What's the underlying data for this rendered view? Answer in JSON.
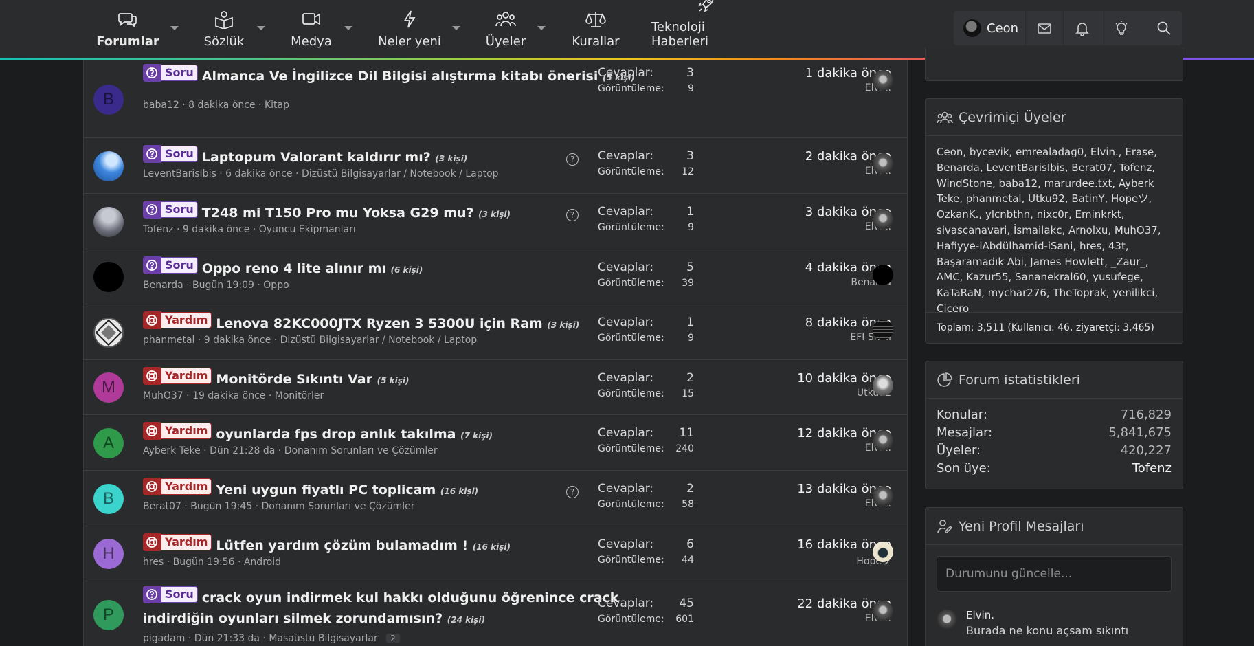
{
  "nav": {
    "items": [
      {
        "label": "Forumlar",
        "icon": "chat-bubbles-icon"
      },
      {
        "label": "Sözlük",
        "icon": "book-icon"
      },
      {
        "label": "Medya",
        "icon": "video-camera-icon"
      },
      {
        "label": "Neler yeni",
        "icon": "lightning-icon"
      },
      {
        "label": "Üyeler",
        "icon": "users-icon"
      },
      {
        "label": "Kurallar",
        "icon": "scales-icon"
      },
      {
        "label": "Teknoloji Haberleri",
        "icon": "rocket-icon"
      }
    ],
    "username": "Ceon",
    "rainbow_colors": [
      "#19c0b0",
      "#a7cf3c",
      "#f2c41c",
      "#f28a1e",
      "#e04a6a",
      "#8a4ee0"
    ]
  },
  "threads": [
    {
      "avatar_letter": "B",
      "avatar_color": "#3a2a8c",
      "prefix": "Soru",
      "title": "Almanca Ve İngilizce Dil Bilgisi alıştırma kitabı önerisi",
      "viewers": "(5 kişi)",
      "author": "baba12",
      "when": "8 dakika önce",
      "forum": "Kitap",
      "replies": "3",
      "views": "9",
      "last_time": "1 dakika önce",
      "last_user": "Elvin."
    },
    {
      "avatar_color": "#2f6fc4",
      "prefix": "Soru",
      "title": "Laptopum Valorant kaldırır mı?",
      "viewers": "(3 kişi)",
      "author": "LeventBarisIbis",
      "when": "6 dakika önce",
      "forum": "Dizüstü Bilgisayarlar / Notebook / Laptop",
      "replies": "3",
      "views": "12",
      "last_time": "2 dakika önce",
      "last_user": "Elvin.",
      "help": "?"
    },
    {
      "avatar_color": "#6a6d78",
      "prefix": "Soru",
      "title": "T248 mi T150 Pro mu Yoksa G29 mu?",
      "viewers": "(3 kişi)",
      "author": "Tofenz",
      "when": "9 dakika önce",
      "forum": "Oyuncu Ekipmanları",
      "replies": "1",
      "views": "9",
      "last_time": "3 dakika önce",
      "last_user": "Elvin.",
      "help": "?"
    },
    {
      "avatar_color": "#000000",
      "prefix": "Soru",
      "title": "Oppo reno 4 lite alınır mı",
      "viewers": "(6 kişi)",
      "author": "Benarda",
      "when": "Bugün 19:09",
      "forum": "Oppo",
      "replies": "5",
      "views": "39",
      "last_time": "4 dakika önce",
      "last_user": "Benarda"
    },
    {
      "avatar_color": "#e8e8e8",
      "prefix": "Yardım",
      "title": "Lenova 82KC000JTX Ryzen 3 5300U için Ram",
      "viewers": "(3 kişi)",
      "author": "phanmetal",
      "when": "9 dakika önce",
      "forum": "Dizüstü Bilgisayarlar / Notebook / Laptop",
      "replies": "1",
      "views": "9",
      "last_time": "8 dakika önce",
      "last_user": "EFI Shell"
    },
    {
      "avatar_letter": "M",
      "avatar_color": "#b03a9a",
      "prefix": "Yardım",
      "title": "Monitörde Sıkıntı Var",
      "viewers": "(5 kişi)",
      "author": "MuhO37",
      "when": "19 dakika önce",
      "forum": "Monitörler",
      "replies": "2",
      "views": "15",
      "last_time": "10 dakika önce",
      "last_user": "Utku92"
    },
    {
      "avatar_letter": "A",
      "avatar_color": "#2e9a4a",
      "prefix": "Yardım",
      "title": "oyunlarda fps drop anlık takılma",
      "viewers": "(7 kişi)",
      "author": "Ayberk Teke",
      "when": "Dün 21:28 da",
      "forum": "Donanım Sorunları ve Çözümler",
      "replies": "11",
      "views": "240",
      "last_time": "12 dakika önce",
      "last_user": "Elvin."
    },
    {
      "avatar_letter": "B",
      "avatar_color": "#3ad4cc",
      "prefix": "Yardım",
      "title": "Yeni uygun fiyatlı PC toplicam",
      "viewers": "(16 kişi)",
      "author": "Berat07",
      "when": "Bugün 19:45",
      "forum": "Donanım Sorunları ve Çözümler",
      "replies": "2",
      "views": "58",
      "last_time": "13 dakika önce",
      "last_user": "Elvin.",
      "help": "?"
    },
    {
      "avatar_letter": "H",
      "avatar_color": "#9b6ad4",
      "prefix": "Yardım",
      "title": "Lütfen yardım çözüm bulamadım !",
      "viewers": "(16 kişi)",
      "author": "hres",
      "when": "Bugün 19:56",
      "forum": "Android",
      "replies": "6",
      "views": "44",
      "last_time": "16 dakika önce",
      "last_user": "Hopeツ"
    },
    {
      "avatar_letter": "P",
      "avatar_color": "#2f9a5c",
      "prefix": "Soru",
      "title": "crack oyun indirmek kul hakkı olduğunu öğrenince crack indirdiğin oyunları silmek zorundamısın?",
      "viewers": "(24 kişi)",
      "author": "pigadam",
      "when": "Dün 21:33 da",
      "forum": "Masaüstü Bilgisayarlar",
      "page": "2",
      "replies": "45",
      "views": "601",
      "last_time": "22 dakika önce",
      "last_user": "Elvin."
    }
  ],
  "labels": {
    "replies": "Cevaplar:",
    "views": "Görüntüleme:"
  },
  "online": {
    "title": "Çevrimiçi Üyeler",
    "members": "Ceon, bycevik, emrealadag0, Elvin., Erase, Benarda, LeventBarisIbis, Berat07, Tofenz, WindStone, baba12, marurdee.txt, Ayberk Teke, phanmetal, Utku92, BatinY, Hopeツ, OzkanK., ylcnbthn, nixc0r, Eminkrkt, sivascanavari, İsmailakc, Arnolxu, MuhO37, Hafiyye-iAbdülhamid-iSani, hres, 43t, Başaramadık Abi, James Howlett, _Zaur_, AMC, Kazur55, Sananekral60, yusufege, KaTaRaN, mychar276, TheToprak, yenilikci, Cicero",
    "total": "Toplam: 3,511 (Kullanıcı: 46, ziyaretçi: 3,465)"
  },
  "forum_stats": {
    "title": "Forum istatistikleri",
    "rows": [
      {
        "label": "Konular:",
        "value": "716,829"
      },
      {
        "label": "Mesajlar:",
        "value": "5,841,675"
      },
      {
        "label": "Üyeler:",
        "value": "420,227"
      },
      {
        "label": "Son üye:",
        "value": "Tofenz"
      }
    ]
  },
  "profile_posts": {
    "title": "Yeni Profil Mesajları",
    "placeholder": "Durumunu güncelle...",
    "post_user": "Elvin.",
    "post_text": "Burada ne konu açsam sıkıntı"
  }
}
